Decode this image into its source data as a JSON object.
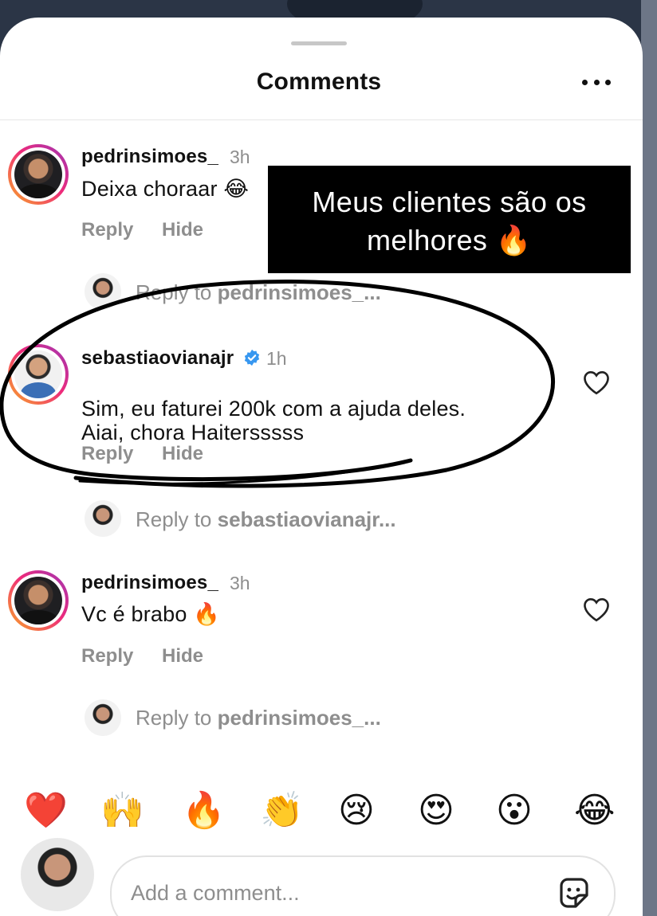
{
  "header": {
    "title": "Comments"
  },
  "comments": [
    {
      "username": "pedrinsimoes_",
      "time": "3h",
      "text": "Deixa choraar",
      "emoji": "😂",
      "reply": "Reply",
      "hide": "Hide",
      "verified": false
    },
    {
      "username": "sebastiaovianajr",
      "time": "1h",
      "text_line1": "Sim, eu faturei 200k com a ajuda deles.",
      "text_line2": "Aiai, chora Haitersssss",
      "reply": "Reply",
      "hide": "Hide",
      "verified": true
    },
    {
      "username": "pedrinsimoes_",
      "time": "3h",
      "text": "Vc é brabo",
      "emoji": "🔥",
      "reply": "Reply",
      "hide": "Hide",
      "verified": false
    }
  ],
  "reply_prompts": [
    {
      "prefix": "Reply to",
      "username": "pedrinsimoes_..."
    },
    {
      "prefix": "Reply to",
      "username": "sebastiaovianajr..."
    },
    {
      "prefix": "Reply to",
      "username": "pedrinsimoes_..."
    }
  ],
  "reactions": [
    "❤️",
    "🙌",
    "🔥",
    "👏",
    "😢",
    "😍",
    "😮",
    "😂"
  ],
  "composer": {
    "placeholder": "Add a comment..."
  },
  "overlay": {
    "line1": "Meus clientes são os",
    "line2": "melhores 🔥"
  },
  "colors": {
    "accent_verified": "#3797f0",
    "muted": "#8e8e8e"
  }
}
